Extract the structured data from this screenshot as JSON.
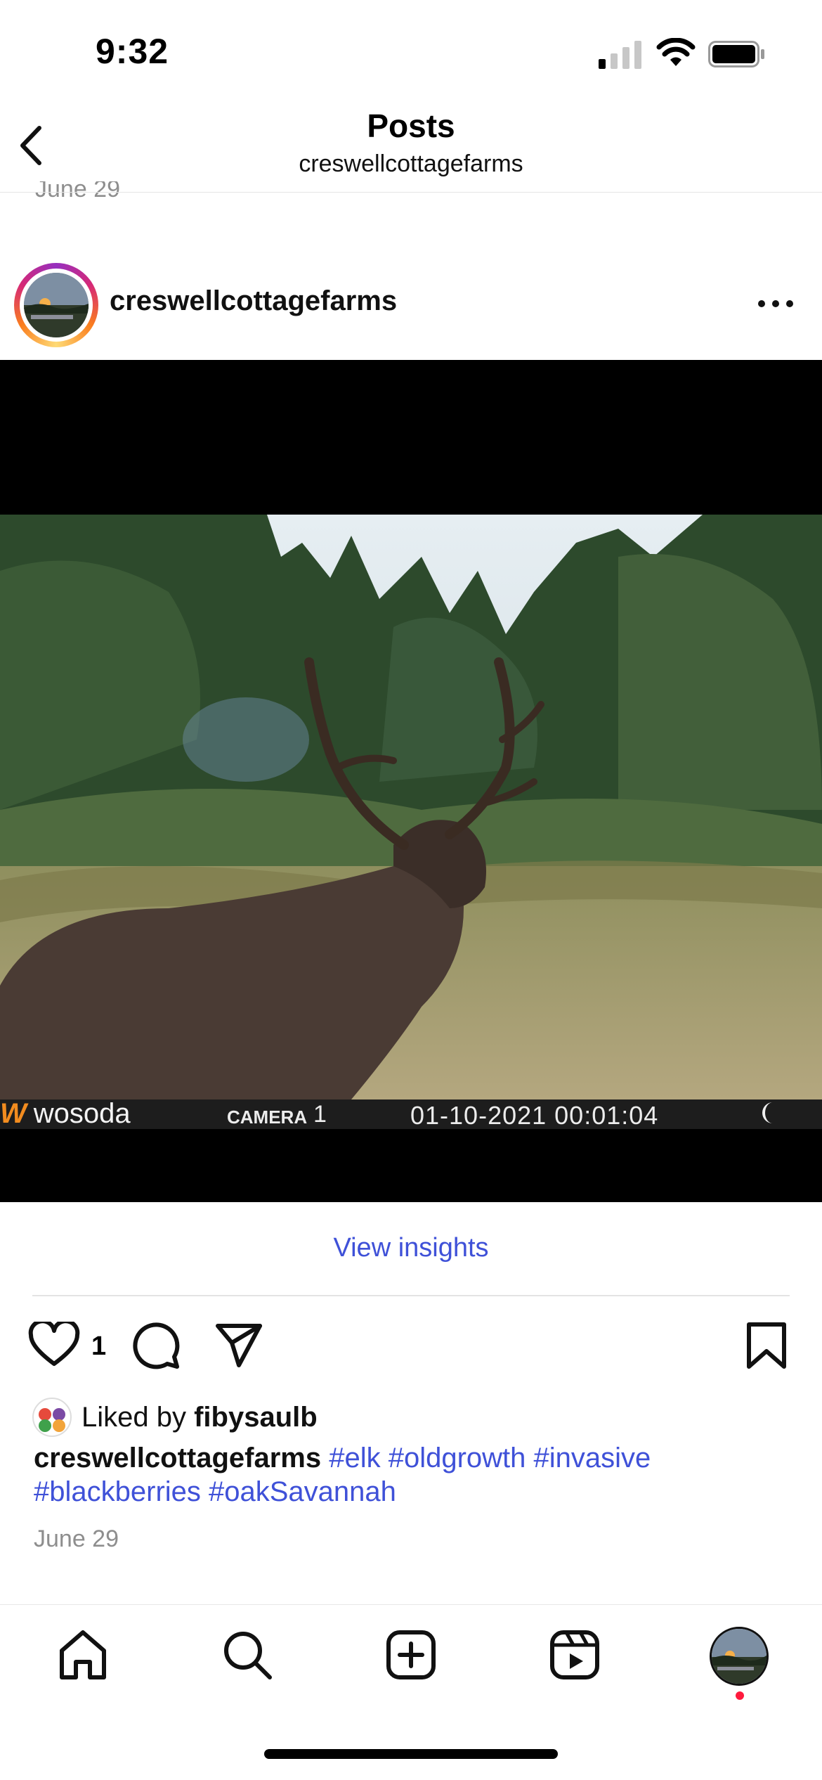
{
  "status_bar": {
    "time": "9:32"
  },
  "header": {
    "title": "Posts",
    "subtitle": "creswellcottagefarms"
  },
  "previous_post": {
    "date": "June 29"
  },
  "post": {
    "username": "creswellcottagefarms",
    "camera_overlay": {
      "brand": "wosoda",
      "camera_label": "CAMERA",
      "camera_number": "1",
      "datetime": "01-10-2021 00:01:04"
    },
    "insights_label": "View insights",
    "like_count": "1",
    "liked_by_prefix": "Liked by",
    "liked_by_user": "fibysaulb",
    "caption_user": "creswellcottagefarms",
    "hashtags": [
      "#elk",
      "#oldgrowth",
      "#invasive",
      "#blackberries",
      "#oakSavannah"
    ],
    "date": "June 29"
  },
  "tab_bar": {
    "items": [
      "home-icon",
      "search-icon",
      "create-icon",
      "reels-icon",
      "profile-avatar"
    ]
  },
  "colors": {
    "link": "#3f51d8",
    "muted": "#8e8e8e",
    "notification": "#ff1a3d"
  }
}
